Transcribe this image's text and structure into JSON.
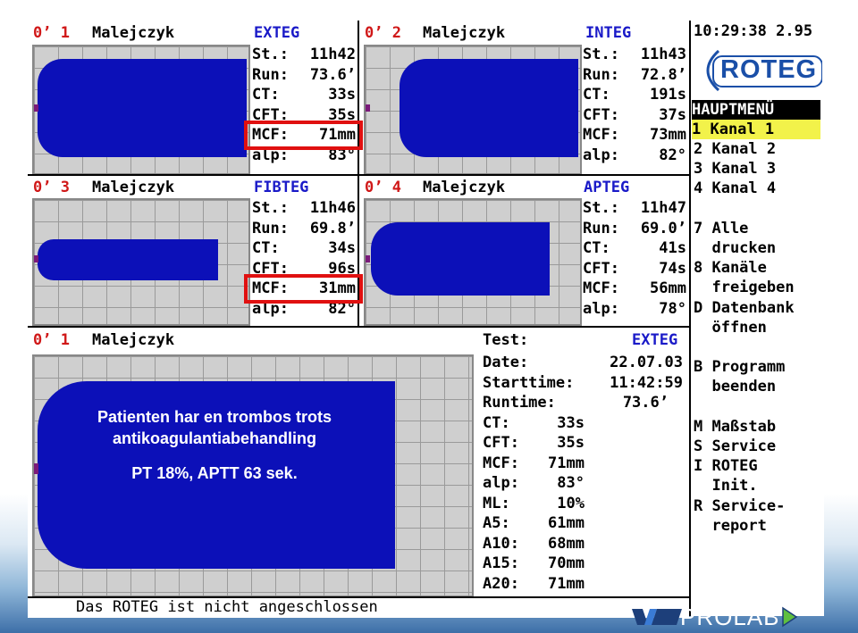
{
  "channels": [
    {
      "number": "0’ 1",
      "patient": "Malejczyk",
      "test": "EXTEG",
      "params": [
        [
          "St.:",
          "11h42"
        ],
        [
          "Run:",
          "73.6’"
        ],
        [
          "CT:",
          "33s"
        ],
        [
          "CFT:",
          "35s"
        ],
        [
          "MCF:",
          "71mm"
        ],
        [
          "alp:",
          "83°"
        ]
      ]
    },
    {
      "number": "0’ 2",
      "patient": "Malejczyk",
      "test": "INTEG",
      "params": [
        [
          "St.:",
          "11h43"
        ],
        [
          "Run:",
          "72.8’"
        ],
        [
          "CT:",
          "191s"
        ],
        [
          "CFT:",
          "37s"
        ],
        [
          "MCF:",
          "73mm"
        ],
        [
          "alp:",
          "82°"
        ]
      ]
    },
    {
      "number": "0’ 3",
      "patient": "Malejczyk",
      "test": "FIBTEG",
      "params": [
        [
          "St.:",
          "11h46"
        ],
        [
          "Run:",
          "69.8’"
        ],
        [
          "CT:",
          "34s"
        ],
        [
          "CFT:",
          "96s"
        ],
        [
          "MCF:",
          "31mm"
        ],
        [
          "alp:",
          "82°"
        ]
      ]
    },
    {
      "number": "0’ 4",
      "patient": "Malejczyk",
      "test": "APTEG",
      "params": [
        [
          "St.:",
          "11h47"
        ],
        [
          "Run:",
          "69.0’"
        ],
        [
          "CT:",
          "41s"
        ],
        [
          "CFT:",
          "74s"
        ],
        [
          "MCF:",
          "56mm"
        ],
        [
          "alp:",
          "78°"
        ]
      ]
    }
  ],
  "detail": {
    "number": "0’ 1",
    "patient": "Malejczyk",
    "test_label": "Test:",
    "test": "EXTEG",
    "params": [
      [
        "Date:",
        "22.07.03"
      ],
      [
        "Starttime:",
        "11:42:59"
      ],
      [
        "Runtime:",
        "73.6’"
      ],
      [
        "CT:",
        "33s"
      ],
      [
        "CFT:",
        "35s"
      ],
      [
        "MCF:",
        "71mm"
      ],
      [
        "alp:",
        "83°"
      ],
      [
        "ML:",
        "10%"
      ],
      [
        "A5:",
        "61mm"
      ],
      [
        "A10:",
        "68mm"
      ],
      [
        "A15:",
        "70mm"
      ],
      [
        "A20:",
        "71mm"
      ]
    ]
  },
  "overlay": {
    "line1": "Patienten har en trombos trots",
    "line2": "antikoagulantiabehandling",
    "line3": "PT 18%,  APTT 63 sek."
  },
  "status_text": "Das ROTEG ist nicht angeschlossen",
  "menu": {
    "clock": "10:29:38 2.95",
    "logo": "ROTEG",
    "title": "HAUPTMENÜ",
    "items": [
      "1 Kanal 1",
      "2 Kanal 2",
      "3 Kanal 3",
      "4 Kanal 4",
      "7 Alle",
      "  drucken",
      "8 Kanäle",
      "  freigeben",
      "D Datenbank",
      "  öffnen",
      "B Programm",
      "  beenden",
      "M Maßstab",
      "S Service",
      "I ROTEG",
      "  Init.",
      "R Service-",
      "  report"
    ]
  },
  "footer_logo": "PROLAB",
  "colors": {
    "trace": "#0c10b8",
    "highlight": "#e01010",
    "menu_selected": "#f2f24a",
    "label_blue": "#1a1ac8"
  }
}
